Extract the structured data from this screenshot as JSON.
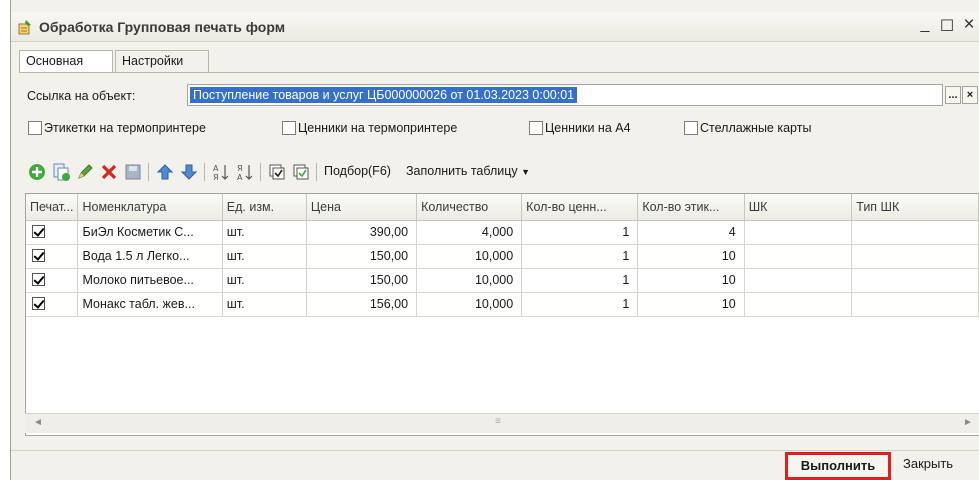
{
  "window": {
    "title": "Обработка  Групповая печать форм",
    "minimize": "_",
    "maximize": "☐",
    "close": "×"
  },
  "tabs": [
    {
      "label": "Основная",
      "active": true
    },
    {
      "label": "Настройки",
      "active": false
    }
  ],
  "link": {
    "label": "Ссылка на объект:",
    "value": "Поступление товаров и услуг ЦБ000000026 от 01.03.2023 0:00:01",
    "select_button": "...",
    "clear_button": "×"
  },
  "options": [
    {
      "label": "Этикетки на термопринтере",
      "checked": false
    },
    {
      "label": "Ценники на термопринтере",
      "checked": false
    },
    {
      "label": "Ценники на А4",
      "checked": false
    },
    {
      "label": "Стеллажные карты",
      "checked": false
    }
  ],
  "toolbar": {
    "add_icon": "add-icon",
    "copy_icon": "copy-icon",
    "edit_icon": "edit-icon",
    "delete_icon": "delete-icon",
    "save_icon": "save-icon",
    "up_icon": "move-up-icon",
    "down_icon": "move-down-icon",
    "sort_asc_icon": "sort-asc-icon",
    "sort_desc_icon": "sort-desc-icon",
    "select_all_icon": "select-all-icon",
    "deselect_all_icon": "deselect-all-icon",
    "pick_label": "Подбор(F6)",
    "fill_label": "Заполнить таблицу"
  },
  "table": {
    "columns": [
      "Печат...",
      "Номенклатура",
      "Ед. изм.",
      "Цена",
      "Количество",
      "Кол-во ценн...",
      "Кол-во этик...",
      "ШК",
      "Тип ШК"
    ],
    "rows": [
      {
        "print": true,
        "name": "БиЭл Косметик С...",
        "unit": "шт.",
        "price": "390,00",
        "qty": "4,000",
        "price_tags": "1",
        "labels": "4",
        "barcode": "",
        "barcode_type": ""
      },
      {
        "print": true,
        "name": "Вода 1.5 л Легко...",
        "unit": "шт.",
        "price": "150,00",
        "qty": "10,000",
        "price_tags": "1",
        "labels": "10",
        "barcode": "",
        "barcode_type": ""
      },
      {
        "print": true,
        "name": "Молоко питьевое...",
        "unit": "шт.",
        "price": "150,00",
        "qty": "10,000",
        "price_tags": "1",
        "labels": "10",
        "barcode": "",
        "barcode_type": ""
      },
      {
        "print": true,
        "name": "Монакс табл. жев...",
        "unit": "шт.",
        "price": "156,00",
        "qty": "10,000",
        "price_tags": "1",
        "labels": "10",
        "barcode": "",
        "barcode_type": ""
      }
    ]
  },
  "footer": {
    "run_label": "Выполнить",
    "close_label": "Закрыть",
    "highlight_color": "#e02020"
  }
}
